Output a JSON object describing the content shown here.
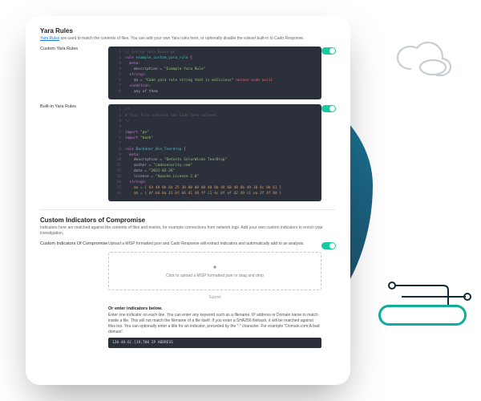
{
  "header": {
    "title": "Yara Rules",
    "desc_pre": "Yara Rules",
    "desc_post": " are used to match the contents of files. You can add your own Yara rules here, or optionally disable the ruleset built-in to Cado Response."
  },
  "custom_yara": {
    "label": "Custom Yara Rules",
    "code_lines": [
      {
        "n": "1",
        "cls": "c-cm",
        "t": "// Custom Yara Rules go"
      },
      {
        "n": "2",
        "cls": "c-kw",
        "t": "rule ",
        "a": "example_custom_yara_rule ",
        "ac": "c-fn",
        "b": "{",
        "bc": ""
      },
      {
        "n": "3",
        "cls": "c-kw",
        "t": "  meta:"
      },
      {
        "n": "4",
        "cls": "",
        "t": "    description = ",
        "a": "\"Example Yara Rule\"",
        "ac": "c-str"
      },
      {
        "n": "5",
        "cls": "c-kw",
        "t": "  strings:"
      },
      {
        "n": "6",
        "cls": "",
        "t": "    $a = ",
        "a": "\"Cado yara rule string that is malicious\"",
        "ac": "c-str",
        "b": " nocase wide ascii",
        "bc": "c-id"
      },
      {
        "n": "7",
        "cls": "c-kw",
        "t": "  condition:"
      },
      {
        "n": "8",
        "cls": "",
        "t": "    any of them"
      }
    ]
  },
  "builtin_yara": {
    "label": "Built-in Yara Rules",
    "code_lines": [
      {
        "n": "1",
        "cls": "c-cm",
        "t": "/*"
      },
      {
        "n": "2",
        "cls": "c-cm",
        "t": "# This file contains the Cado Yara ruleset"
      },
      {
        "n": "3",
        "cls": "c-cm",
        "t": "*/"
      },
      {
        "n": "4",
        "cls": "",
        "t": ""
      },
      {
        "n": "5",
        "cls": "c-kw",
        "t": "import ",
        "a": "\"pe\"",
        "ac": "c-str"
      },
      {
        "n": "6",
        "cls": "c-kw",
        "t": "import ",
        "a": "\"hash\"",
        "ac": "c-str"
      },
      {
        "n": "7",
        "cls": "",
        "t": ""
      },
      {
        "n": "8",
        "cls": "c-kw",
        "t": "rule ",
        "a": "Backdoor_Win_Teardrop ",
        "ac": "c-fn",
        "b": "{",
        "bc": ""
      },
      {
        "n": "9",
        "cls": "c-kw",
        "t": "  meta:"
      },
      {
        "n": "10",
        "cls": "",
        "t": "    description = ",
        "a": "\"Detects SolarWinds TearDrop\"",
        "ac": "c-str"
      },
      {
        "n": "11",
        "cls": "",
        "t": "    author = ",
        "a": "\"cadosecurity.com\"",
        "ac": "c-str"
      },
      {
        "n": "12",
        "cls": "",
        "t": "    date = ",
        "a": "\"2021-02-26\"",
        "ac": "c-str"
      },
      {
        "n": "13",
        "cls": "",
        "t": "    license = ",
        "a": "\"Apache License 2.0\"",
        "ac": "c-str"
      },
      {
        "n": "14",
        "cls": "c-kw",
        "t": "  strings:"
      },
      {
        "n": "15",
        "cls": "c-num",
        "t": "    $a = { 64 48 8b 04 25 30 00 00 00 48 8b 48 60 48 8b 49 18 4c 8b 61 }"
      },
      {
        "n": "16",
        "cls": "c-num",
        "t": "    $b = { 0f b6 0a 41 0f b6 d1 48 ff c2 4c 0f af d2 49 c1 ea 2f 4f 8d }"
      }
    ]
  },
  "ioc": {
    "title": "Custom Indicators of Compromise",
    "desc": "Indicators here are matched against the contents of files and events, for example connections from network logs. Add your own custom indicators to enrich your investigation.",
    "label": "Custom Indicators Of Compromise",
    "upload_note": "Upload a MISP formatted json and Cado Response will extract indicators and automatically add to an analysis.",
    "upload_box": "Click to upload a MISP formatted json or drag and drop",
    "submit": "Submit",
    "manual_head": "Or enter indicators below.",
    "manual_note": "Enter one indicator on each line. You can enter any keyword such as a filename, IP address or Domain name to match inside a file. This will not match the filename of a file itself. If you enter a SHA256 filehash, it will be matched against files too. You can optionally enter a title for an indicator, preceded by the \";\" character. For example \"Domain.com;A bad domain\".",
    "manual_value": "120.48.6[.]19;T00 IP ADDRESS"
  }
}
